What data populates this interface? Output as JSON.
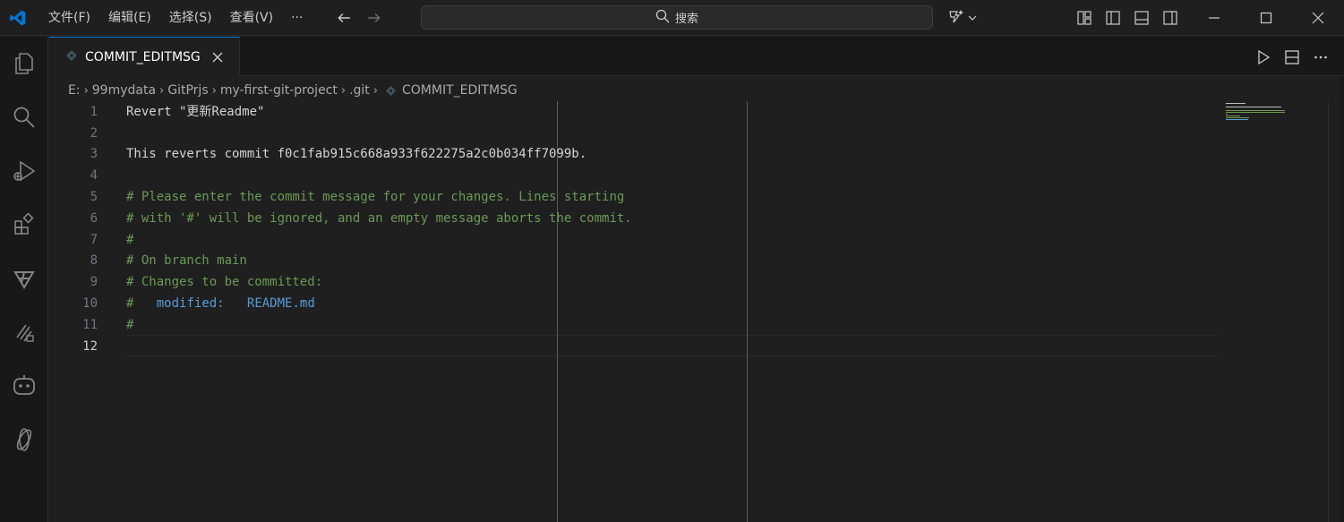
{
  "titlebar": {
    "menu": [
      "文件(F)",
      "编辑(E)",
      "选择(S)",
      "查看(V)",
      "···"
    ],
    "search_label": "搜索"
  },
  "tab": {
    "label": "COMMIT_EDITMSG"
  },
  "breadcrumb": [
    "E:",
    "99mydata",
    "GitPrjs",
    "my-first-git-project",
    ".git",
    "COMMIT_EDITMSG"
  ],
  "editor": {
    "active_line": 12,
    "lines": [
      {
        "n": "1",
        "text": "Revert \"更新Readme\""
      },
      {
        "n": "2",
        "text": ""
      },
      {
        "n": "3",
        "text": "This reverts commit f0c1fab915c668a933f622275a2c0b034ff7099b."
      },
      {
        "n": "4",
        "text": ""
      },
      {
        "n": "5",
        "text": "# Please enter the commit message for your changes. Lines starting"
      },
      {
        "n": "6",
        "text": "# with '#' will be ignored, and an empty message aborts the commit."
      },
      {
        "n": "7",
        "text": "#"
      },
      {
        "n": "8",
        "text": "# On branch main"
      },
      {
        "n": "9",
        "text": "# Changes to be committed:"
      },
      {
        "n": "10",
        "hash": "#",
        "status": "modified:",
        "file": "README.md"
      },
      {
        "n": "11",
        "text": "#"
      },
      {
        "n": "12",
        "text": ""
      }
    ]
  },
  "colors": {
    "accent": "#0078d4",
    "comment": "#6a9955",
    "keyword": "#569cd6",
    "background": "#1f1f1f"
  }
}
